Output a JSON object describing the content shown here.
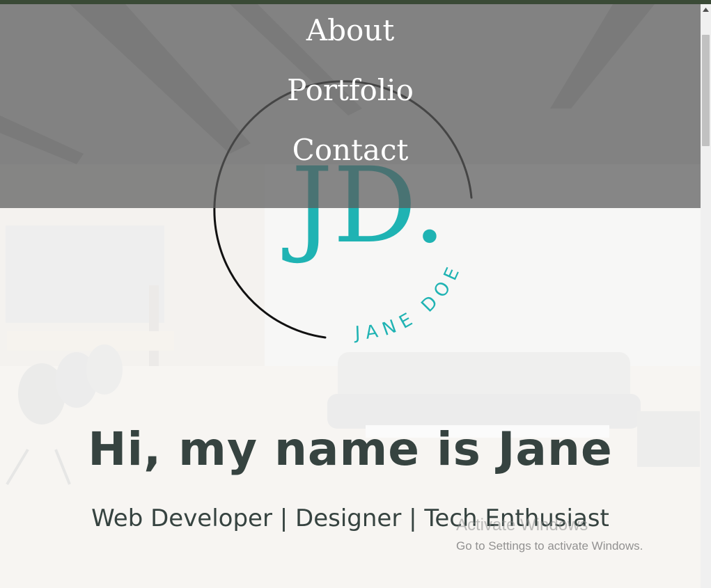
{
  "nav": {
    "items": [
      {
        "label": "About"
      },
      {
        "label": "Portfolio"
      },
      {
        "label": "Contact"
      }
    ]
  },
  "logo": {
    "monogram": "JD.",
    "name": "JANE DOE",
    "accent_color": "#1fb3b3",
    "ring_color": "#111111"
  },
  "hero": {
    "title": "Hi, my name is Jane",
    "subtitle": "Web Developer | Designer | Tech Enthusiast",
    "text_color": "#364340"
  },
  "watermark": {
    "title": "Activate Windows",
    "subtitle": "Go to Settings to activate Windows."
  },
  "scrollbar": {
    "up_arrow_icon": "triangle-up-icon"
  }
}
